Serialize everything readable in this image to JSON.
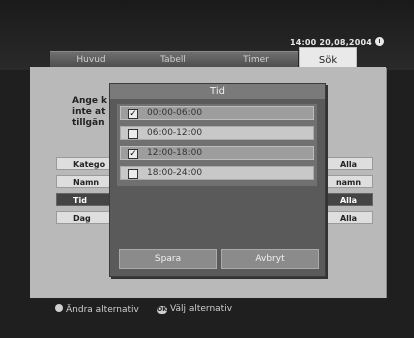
{
  "clock": "14:00 20,08,2004",
  "tabs": [
    "Huvud",
    "Tabell",
    "Timer",
    "Sök"
  ],
  "help_text": [
    "Ange k",
    "inte at",
    "tillgän"
  ],
  "rows": [
    {
      "label": "Katego",
      "value": "Alla"
    },
    {
      "label": "Namn",
      "value": "namn"
    },
    {
      "label": "Tid",
      "value": "Alla"
    },
    {
      "label": "Dag",
      "value": "Alla"
    }
  ],
  "dialog": {
    "title": "Tid",
    "options": [
      {
        "label": "00:00-06:00",
        "checked": true,
        "selected": true
      },
      {
        "label": "06:00-12:00",
        "checked": false,
        "selected": false
      },
      {
        "label": "12:00-18:00",
        "checked": true,
        "selected": true
      },
      {
        "label": "18:00-24:00",
        "checked": false,
        "selected": false
      }
    ],
    "save": "Spara",
    "cancel": "Avbryt"
  },
  "footer": {
    "change": "Ändra alternativ",
    "ok_key": "OK",
    "select": "Välj alternativ"
  }
}
